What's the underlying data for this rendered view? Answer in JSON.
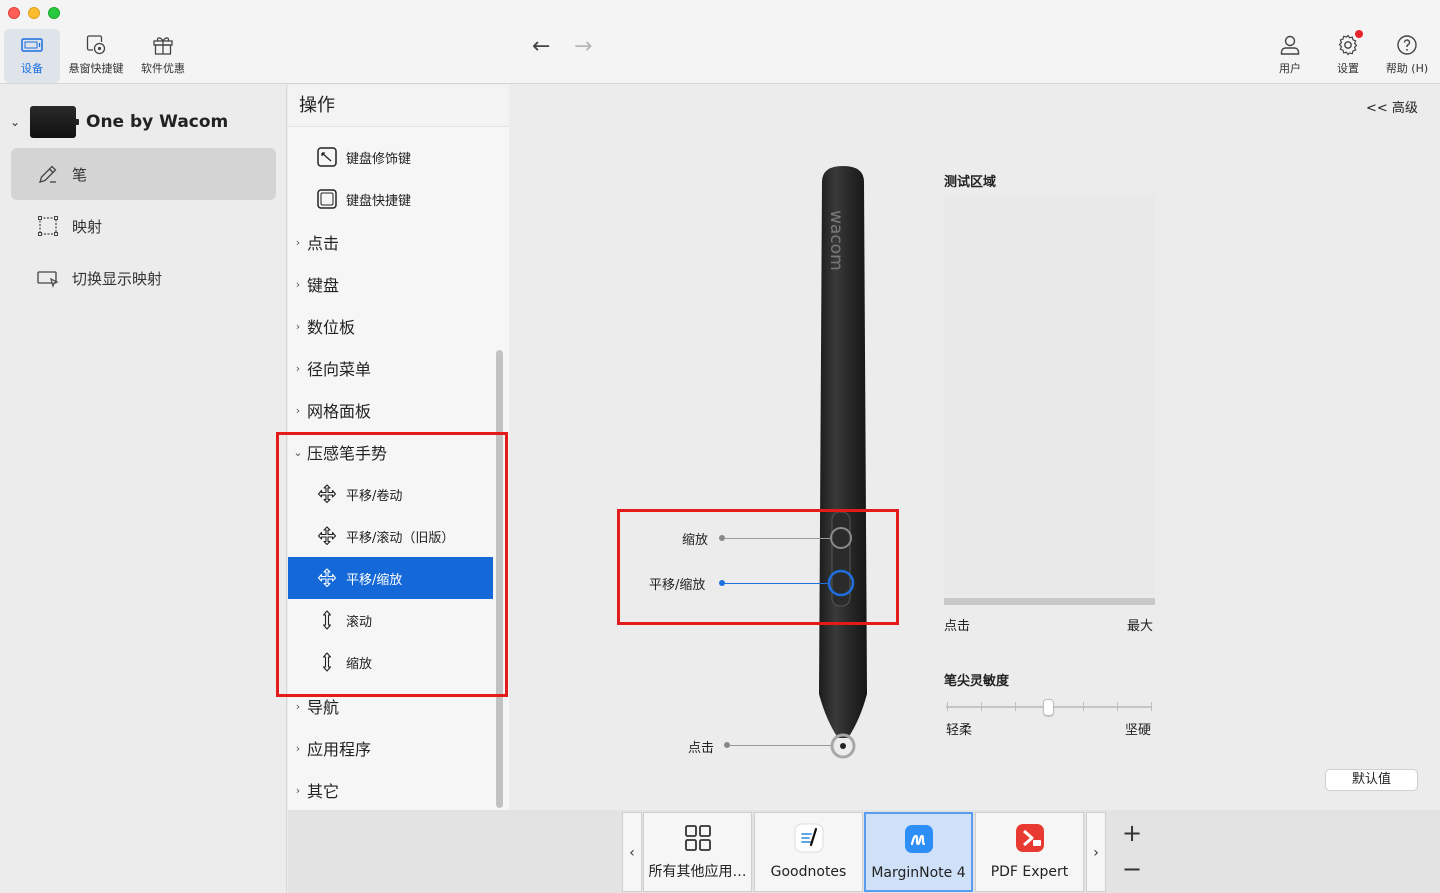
{
  "toolbar": {
    "buttons": [
      {
        "label": "设备",
        "icon": "tablet-icon",
        "active": true
      },
      {
        "label": "悬窗快捷键",
        "icon": "onscreen-controls-icon"
      },
      {
        "label": "软件优惠",
        "icon": "gift-icon"
      }
    ],
    "right_buttons": [
      {
        "label": "用户",
        "icon": "user-icon"
      },
      {
        "label": "设置",
        "icon": "gear-icon"
      },
      {
        "label": "帮助 (H)",
        "icon": "help-icon"
      }
    ]
  },
  "sidebar": {
    "device_name": "One by Wacom",
    "items": [
      {
        "label": "笔",
        "icon": "pen-icon",
        "selected": true
      },
      {
        "label": "映射",
        "icon": "mapping-icon"
      },
      {
        "label": "切换显示映射",
        "icon": "display-toggle-icon"
      }
    ]
  },
  "actions": {
    "title": "操作",
    "items": [
      {
        "kind": "sub",
        "label": "键盘修饰键",
        "icon": "modifier-key-icon"
      },
      {
        "kind": "sub",
        "label": "键盘快捷键",
        "icon": "keystroke-icon"
      },
      {
        "kind": "cat",
        "label": "点击",
        "expanded": false
      },
      {
        "kind": "cat",
        "label": "键盘",
        "expanded": false
      },
      {
        "kind": "cat",
        "label": "数位板",
        "expanded": false
      },
      {
        "kind": "cat",
        "label": "径向菜单",
        "expanded": false
      },
      {
        "kind": "cat",
        "label": "网格面板",
        "expanded": false
      },
      {
        "kind": "cat",
        "label": "压感笔手势",
        "expanded": true
      },
      {
        "kind": "sub",
        "label": "平移/卷动",
        "icon": "move-arrows-icon"
      },
      {
        "kind": "sub",
        "label": "平移/滚动（旧版）",
        "icon": "move-arrows-icon"
      },
      {
        "kind": "sub",
        "label": "平移/缩放",
        "icon": "move-arrows-icon",
        "highlighted": true
      },
      {
        "kind": "sub",
        "label": "滚动",
        "icon": "vertical-arrows-icon"
      },
      {
        "kind": "sub",
        "label": "缩放",
        "icon": "vertical-arrows-icon"
      },
      {
        "kind": "cat",
        "label": "导航",
        "expanded": false
      },
      {
        "kind": "cat",
        "label": "应用程序",
        "expanded": false
      },
      {
        "kind": "cat",
        "label": "其它",
        "expanded": false
      }
    ]
  },
  "main": {
    "advanced_link": "<< 高级",
    "pen": {
      "brand": "wacom",
      "upper_button_label": "缩放",
      "lower_button_label": "平移/缩放",
      "tip_label": "点击"
    },
    "test_area": {
      "title": "测试区域",
      "pressure_min": "点击",
      "pressure_max": "最大"
    },
    "tip_feel": {
      "title": "笔尖灵敏度",
      "min_label": "轻柔",
      "max_label": "坚硬",
      "level": 0.5
    },
    "default_button": "默认值"
  },
  "apps": {
    "tiles": [
      {
        "name": "所有其他应用…",
        "icon": "grid-icon"
      },
      {
        "name": "Goodnotes",
        "icon": "goodnotes-icon"
      },
      {
        "name": "MarginNote 4",
        "icon": "marginnote-icon",
        "selected": true
      },
      {
        "name": "PDF Expert",
        "icon": "pdf-expert-icon"
      }
    ],
    "add_symbol": "+",
    "remove_symbol": "−",
    "prev_symbol": "‹",
    "next_symbol": "›"
  },
  "colors": {
    "accent": "#1468d8",
    "highlight_box": "#e31b1b",
    "selected_app_bg": "#cfe0f9",
    "notification_dot": "#e8232b"
  }
}
